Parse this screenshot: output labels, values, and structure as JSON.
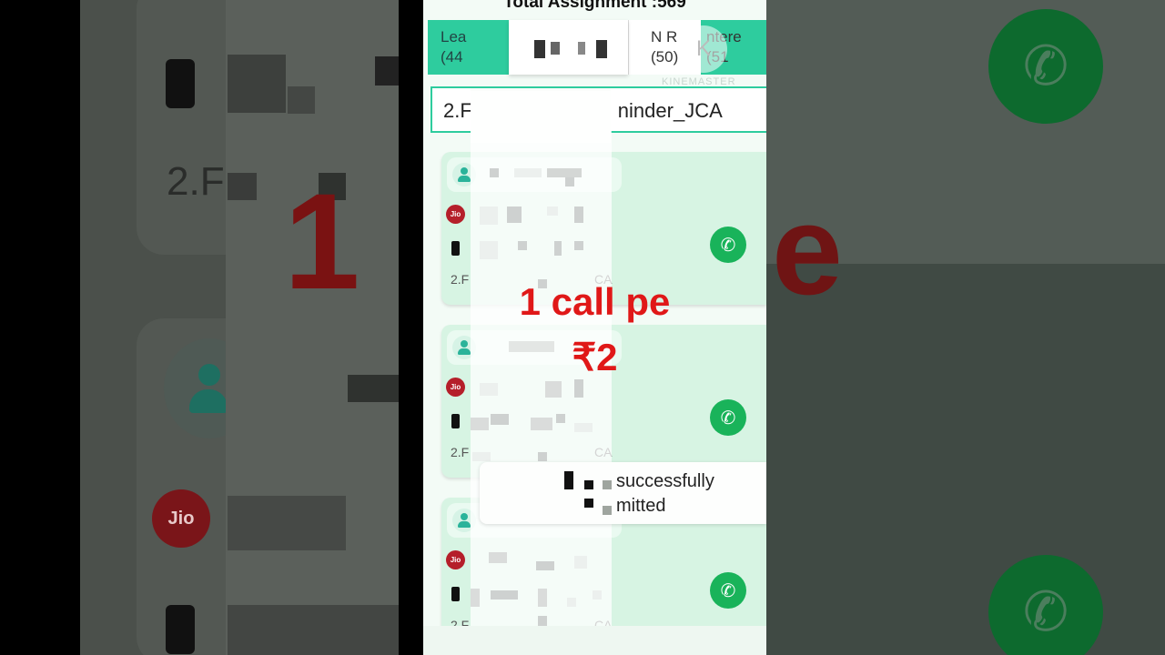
{
  "header": {
    "total_label": "Total Assignment :569"
  },
  "tabs": [
    {
      "line1": "Lea",
      "line2": "(44"
    },
    {
      "line1": "",
      "line2": ""
    },
    {
      "line1": "N R",
      "line2": "(50)"
    },
    {
      "line1": "ntere",
      "line2": "(51"
    }
  ],
  "watermark": {
    "text": "KINEMASTER",
    "letter": "K"
  },
  "filter": {
    "prefix": "2.F",
    "suffix": "ninder_JCA"
  },
  "cards": [
    {
      "prefix": "2.F",
      "suffix": "CA",
      "jio": "Jio"
    },
    {
      "prefix": "2.F",
      "suffix": "CA",
      "jio": "Jio"
    },
    {
      "prefix": "2.F",
      "suffix": "CA",
      "jio": "Jio"
    }
  ],
  "overlay": {
    "line1": "1 call pe",
    "line2": "₹2"
  },
  "toast": {
    "line1": "successfully",
    "line2": "mitted"
  },
  "background": {
    "left_text": "2.F",
    "left_big": "1",
    "right_big": "e",
    "jio": "Jio"
  },
  "colors": {
    "accent": "#2ecc9e",
    "call_green": "#19b35a",
    "overlay_red": "#e01818",
    "jio_red": "#b51f2a"
  },
  "icons": [
    "person-icon",
    "jio-icon",
    "phone-icon",
    "call-icon"
  ]
}
